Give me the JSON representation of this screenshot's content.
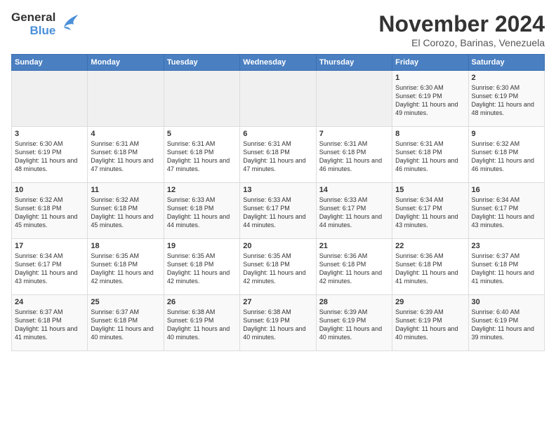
{
  "logo": {
    "general": "General",
    "blue": "Blue"
  },
  "title": "November 2024",
  "location": "El Corozo, Barinas, Venezuela",
  "days_of_week": [
    "Sunday",
    "Monday",
    "Tuesday",
    "Wednesday",
    "Thursday",
    "Friday",
    "Saturday"
  ],
  "weeks": [
    [
      {
        "day": "",
        "content": ""
      },
      {
        "day": "",
        "content": ""
      },
      {
        "day": "",
        "content": ""
      },
      {
        "day": "",
        "content": ""
      },
      {
        "day": "",
        "content": ""
      },
      {
        "day": "1",
        "content": "Sunrise: 6:30 AM\nSunset: 6:19 PM\nDaylight: 11 hours and 49 minutes."
      },
      {
        "day": "2",
        "content": "Sunrise: 6:30 AM\nSunset: 6:19 PM\nDaylight: 11 hours and 48 minutes."
      }
    ],
    [
      {
        "day": "3",
        "content": "Sunrise: 6:30 AM\nSunset: 6:19 PM\nDaylight: 11 hours and 48 minutes."
      },
      {
        "day": "4",
        "content": "Sunrise: 6:31 AM\nSunset: 6:18 PM\nDaylight: 11 hours and 47 minutes."
      },
      {
        "day": "5",
        "content": "Sunrise: 6:31 AM\nSunset: 6:18 PM\nDaylight: 11 hours and 47 minutes."
      },
      {
        "day": "6",
        "content": "Sunrise: 6:31 AM\nSunset: 6:18 PM\nDaylight: 11 hours and 47 minutes."
      },
      {
        "day": "7",
        "content": "Sunrise: 6:31 AM\nSunset: 6:18 PM\nDaylight: 11 hours and 46 minutes."
      },
      {
        "day": "8",
        "content": "Sunrise: 6:31 AM\nSunset: 6:18 PM\nDaylight: 11 hours and 46 minutes."
      },
      {
        "day": "9",
        "content": "Sunrise: 6:32 AM\nSunset: 6:18 PM\nDaylight: 11 hours and 46 minutes."
      }
    ],
    [
      {
        "day": "10",
        "content": "Sunrise: 6:32 AM\nSunset: 6:18 PM\nDaylight: 11 hours and 45 minutes."
      },
      {
        "day": "11",
        "content": "Sunrise: 6:32 AM\nSunset: 6:18 PM\nDaylight: 11 hours and 45 minutes."
      },
      {
        "day": "12",
        "content": "Sunrise: 6:33 AM\nSunset: 6:18 PM\nDaylight: 11 hours and 44 minutes."
      },
      {
        "day": "13",
        "content": "Sunrise: 6:33 AM\nSunset: 6:17 PM\nDaylight: 11 hours and 44 minutes."
      },
      {
        "day": "14",
        "content": "Sunrise: 6:33 AM\nSunset: 6:17 PM\nDaylight: 11 hours and 44 minutes."
      },
      {
        "day": "15",
        "content": "Sunrise: 6:34 AM\nSunset: 6:17 PM\nDaylight: 11 hours and 43 minutes."
      },
      {
        "day": "16",
        "content": "Sunrise: 6:34 AM\nSunset: 6:17 PM\nDaylight: 11 hours and 43 minutes."
      }
    ],
    [
      {
        "day": "17",
        "content": "Sunrise: 6:34 AM\nSunset: 6:17 PM\nDaylight: 11 hours and 43 minutes."
      },
      {
        "day": "18",
        "content": "Sunrise: 6:35 AM\nSunset: 6:18 PM\nDaylight: 11 hours and 42 minutes."
      },
      {
        "day": "19",
        "content": "Sunrise: 6:35 AM\nSunset: 6:18 PM\nDaylight: 11 hours and 42 minutes."
      },
      {
        "day": "20",
        "content": "Sunrise: 6:35 AM\nSunset: 6:18 PM\nDaylight: 11 hours and 42 minutes."
      },
      {
        "day": "21",
        "content": "Sunrise: 6:36 AM\nSunset: 6:18 PM\nDaylight: 11 hours and 42 minutes."
      },
      {
        "day": "22",
        "content": "Sunrise: 6:36 AM\nSunset: 6:18 PM\nDaylight: 11 hours and 41 minutes."
      },
      {
        "day": "23",
        "content": "Sunrise: 6:37 AM\nSunset: 6:18 PM\nDaylight: 11 hours and 41 minutes."
      }
    ],
    [
      {
        "day": "24",
        "content": "Sunrise: 6:37 AM\nSunset: 6:18 PM\nDaylight: 11 hours and 41 minutes."
      },
      {
        "day": "25",
        "content": "Sunrise: 6:37 AM\nSunset: 6:18 PM\nDaylight: 11 hours and 40 minutes."
      },
      {
        "day": "26",
        "content": "Sunrise: 6:38 AM\nSunset: 6:19 PM\nDaylight: 11 hours and 40 minutes."
      },
      {
        "day": "27",
        "content": "Sunrise: 6:38 AM\nSunset: 6:19 PM\nDaylight: 11 hours and 40 minutes."
      },
      {
        "day": "28",
        "content": "Sunrise: 6:39 AM\nSunset: 6:19 PM\nDaylight: 11 hours and 40 minutes."
      },
      {
        "day": "29",
        "content": "Sunrise: 6:39 AM\nSunset: 6:19 PM\nDaylight: 11 hours and 40 minutes."
      },
      {
        "day": "30",
        "content": "Sunrise: 6:40 AM\nSunset: 6:19 PM\nDaylight: 11 hours and 39 minutes."
      }
    ]
  ]
}
